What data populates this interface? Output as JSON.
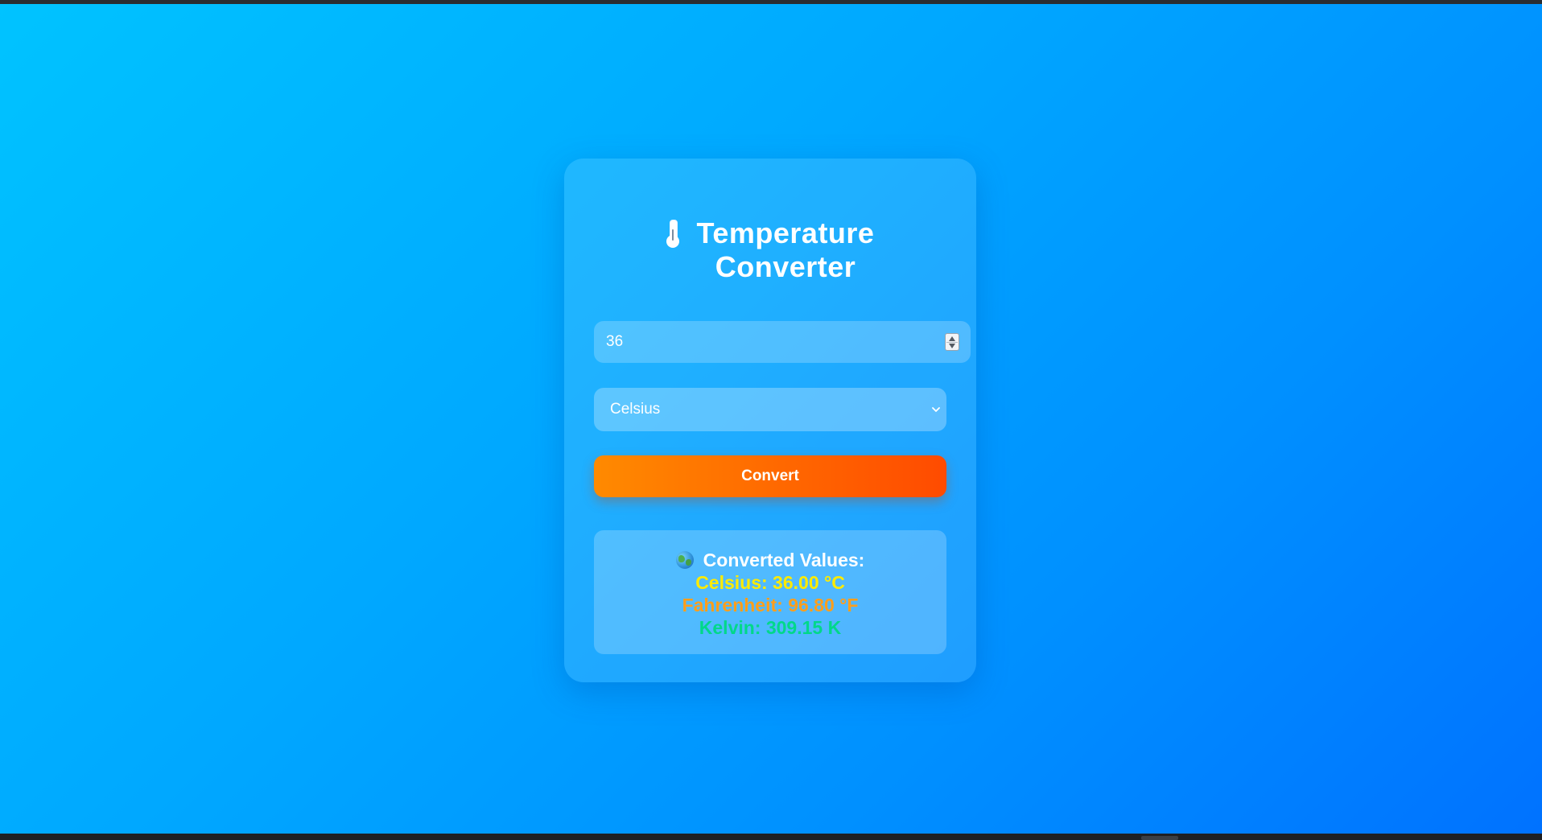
{
  "app": {
    "title_line1": "Temperature",
    "title_line2": "Converter"
  },
  "input": {
    "value": "36"
  },
  "unit_select": {
    "selected": "Celsius"
  },
  "convert_button": {
    "label": "Convert"
  },
  "results": {
    "heading": "Converted Values:",
    "celsius": "Celsius: 36.00 °C",
    "fahrenheit": "Fahrenheit: 96.80 °F",
    "kelvin": "Kelvin: 309.15 K"
  },
  "icons": {
    "title_icon": "thermometer-icon",
    "results_icon": "globe-icon",
    "select_icon": "chevron-down-icon"
  },
  "colors": {
    "background_start": "#00c3ff",
    "background_end": "#0072ff",
    "button_start": "#ff8a00",
    "button_end": "#ff4b00",
    "celsius_text": "#ffeb00",
    "fahrenheit_text": "#ff9e1b",
    "kelvin_text": "#00d88a"
  }
}
